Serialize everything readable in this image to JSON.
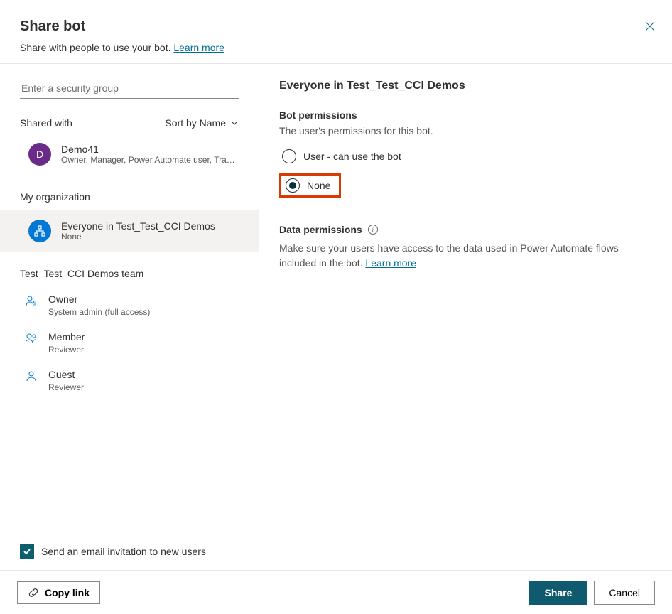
{
  "header": {
    "title": "Share bot",
    "subtitle": "Share with people to use your bot. ",
    "learn_more": "Learn more"
  },
  "left": {
    "search_placeholder": "Enter a security group",
    "shared_with_label": "Shared with",
    "sort_label": "Sort by Name",
    "user": {
      "avatar_letter": "D",
      "name": "Demo41",
      "role": "Owner, Manager, Power Automate user, Transc..."
    },
    "org_label": "My organization",
    "org_item": {
      "name": "Everyone in Test_Test_CCI Demos",
      "sub": "None"
    },
    "team_label": "Test_Test_CCI Demos team",
    "team": [
      {
        "name": "Owner",
        "sub": "System admin (full access)"
      },
      {
        "name": "Member",
        "sub": "Reviewer"
      },
      {
        "name": "Guest",
        "sub": "Reviewer"
      }
    ],
    "email_checkbox_label": "Send an email invitation to new users"
  },
  "right": {
    "title": "Everyone in Test_Test_CCI Demos",
    "bot_perm_heading": "Bot permissions",
    "bot_perm_desc": "The user's permissions for this bot.",
    "radio_user": "User - can use the bot",
    "radio_none": "None",
    "data_perm_heading": "Data permissions",
    "data_perm_desc": "Make sure your users have access to the data used in Power Automate flows included in the bot. ",
    "data_learn_more": "Learn more"
  },
  "footer": {
    "copy_link": "Copy link",
    "share": "Share",
    "cancel": "Cancel"
  }
}
